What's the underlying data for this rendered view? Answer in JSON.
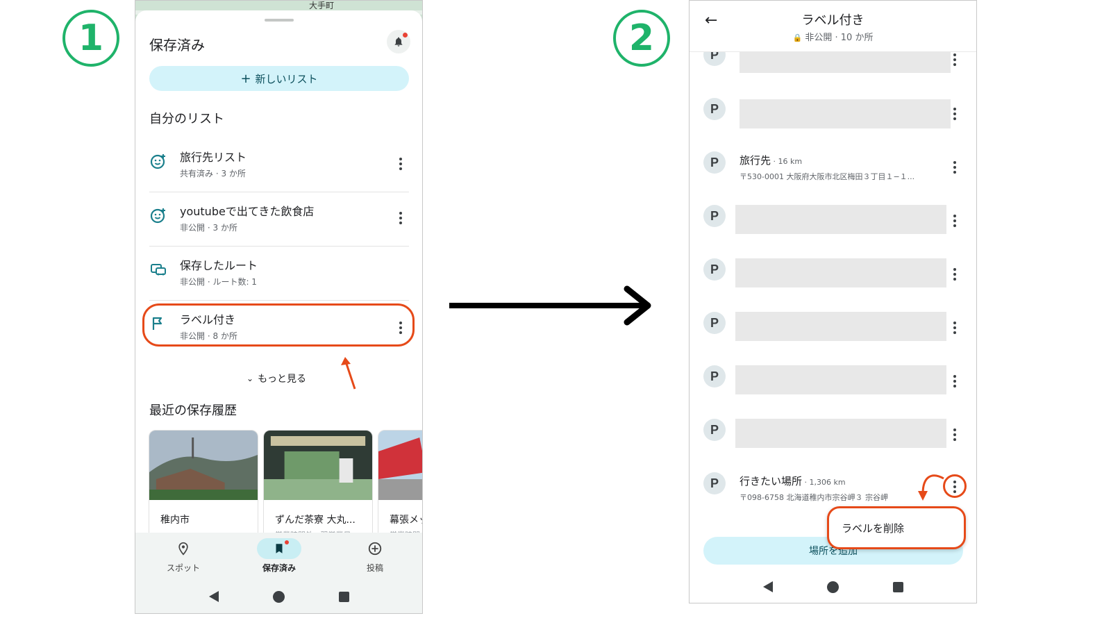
{
  "step_labels": [
    "1",
    "2"
  ],
  "accent_color": "#1fb36a",
  "highlight_color": "#e64a19",
  "screen1": {
    "map_label": "大手町",
    "title": "保存済み",
    "new_list_button": "新しいリスト",
    "my_lists_title": "自分のリスト",
    "lists": [
      {
        "name": "旅行先リスト",
        "meta": "共有済み · 3 か所",
        "icon": "smiley-list-icon"
      },
      {
        "name": "youtubeで出てきた飲食店",
        "meta": "非公開 · 3 か所",
        "icon": "smiley-list-icon"
      },
      {
        "name": "保存したルート",
        "meta": "非公開 · ルート数: 1",
        "icon": "route-icon"
      },
      {
        "name": "ラベル付き",
        "meta": "非公開 · 8 か所",
        "icon": "flag-icon"
      }
    ],
    "more_link": "もっと見る",
    "recent_title": "最近の保存履歴",
    "recent": [
      {
        "name": "稚内市",
        "sub": ""
      },
      {
        "name": "ずんだ茶寮 大丸...",
        "sub": "営業時間外 · 翌営業日"
      },
      {
        "name": "幕張メッ",
        "sub": "営業時間"
      }
    ],
    "nav": [
      {
        "label": "スポット",
        "icon": "location-pin-icon"
      },
      {
        "label": "保存済み",
        "icon": "bookmark-icon"
      },
      {
        "label": "投稿",
        "icon": "add-circle-icon"
      }
    ]
  },
  "screen2": {
    "title": "ラベル付き",
    "subtitle": "非公開 · 10 か所",
    "avatar_letter": "P",
    "places": [
      {
        "name": "旅行先",
        "distance": " · 16 km",
        "address": "〒530-0001 大阪府大阪市北区梅田３丁目１−１..."
      },
      {
        "name": "行きたい場所",
        "distance": " · 1,306 km",
        "address": "〒098-6758 北海道稚内市宗谷岬３ 宗谷岬"
      }
    ],
    "add_place_button": "場所を追加",
    "popup_item": "ラベルを削除"
  }
}
